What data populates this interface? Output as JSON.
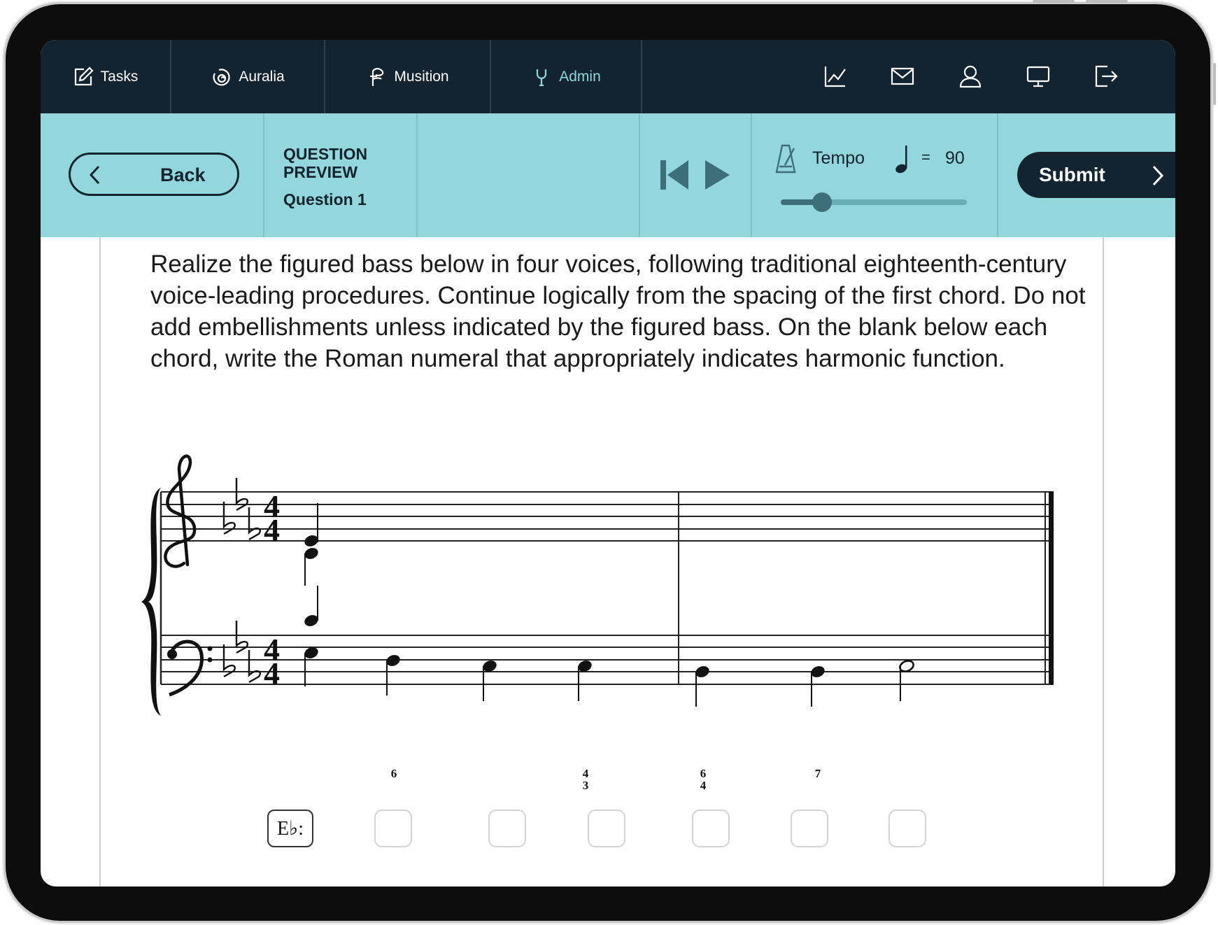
{
  "nav": {
    "tabs": [
      {
        "label": "Tasks",
        "icon": "edit-icon"
      },
      {
        "label": "Auralia",
        "icon": "auralia-logo-icon"
      },
      {
        "label": "Musition",
        "icon": "musition-logo-icon"
      },
      {
        "label": "Admin",
        "icon": "wrench-icon",
        "active": true
      }
    ],
    "right_icons": [
      "chart-icon",
      "mail-icon",
      "user-icon",
      "monitor-icon",
      "logout-icon"
    ]
  },
  "toolbar": {
    "back_label": "Back",
    "title": "QUESTION PREVIEW",
    "subtitle": "Question 1",
    "tempo_label": "Tempo",
    "tempo_equals": "=",
    "tempo_value": "90",
    "tempo_slider_fraction": 0.22,
    "submit_label": "Submit"
  },
  "question": {
    "instructions": "Realize the figured bass below in four voices, following traditional eighteenth-century voice-leading procedures. Continue logically from the spacing of the first chord. Do not add embellishments unless indicated by the figured bass. On the blank below each chord, write the Roman numeral that appropriately indicates harmonic function.",
    "key_label": "E♭:",
    "figures": [
      {
        "top": "6",
        "bottom": ""
      },
      {
        "top": "4",
        "bottom": "3"
      },
      {
        "top": "6",
        "bottom": "4"
      },
      {
        "top": "7",
        "bottom": ""
      }
    ],
    "answer_blanks": 7
  },
  "colors": {
    "nav_bg": "#132430",
    "toolbar_bg": "#93d6dc",
    "accent": "#8fd6dd",
    "device_bezel": "#0d0d0d"
  }
}
